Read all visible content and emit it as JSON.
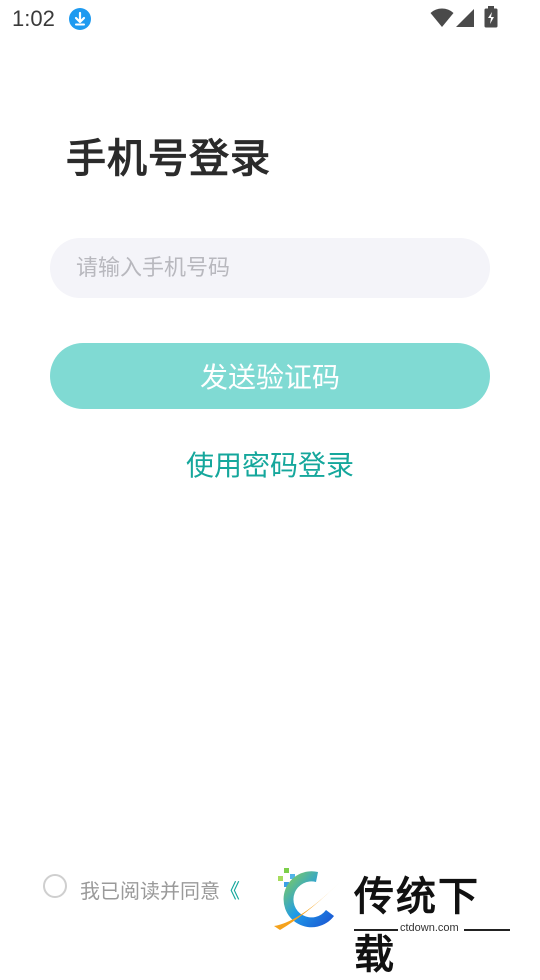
{
  "status_bar": {
    "time": "1:02"
  },
  "login": {
    "title": "手机号登录",
    "phone_placeholder": "请输入手机号码",
    "phone_value": "",
    "send_code_label": "发送验证码",
    "password_login_label": "使用密码登录"
  },
  "agreement": {
    "checked": false,
    "prefix": "我已阅读并同意",
    "link_fragment": "《"
  },
  "watermark": {
    "title": "传统下载",
    "url": "ctdown.com"
  },
  "colors": {
    "accent": "#15a79c",
    "button_bg": "#80dad3",
    "input_bg": "#f4f4f9",
    "title": "#2b2b2b"
  }
}
